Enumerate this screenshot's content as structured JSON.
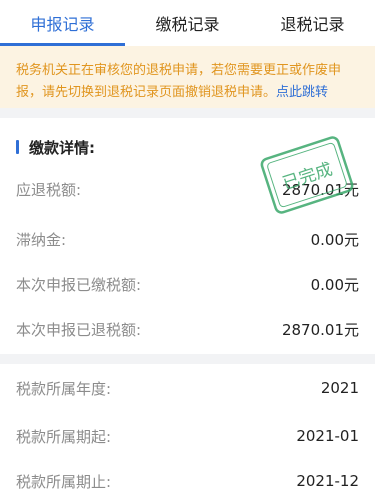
{
  "tabs": [
    {
      "label": "申报记录"
    },
    {
      "label": "缴税记录"
    },
    {
      "label": "退税记录"
    }
  ],
  "notice": {
    "text": "税务机关正在审核您的退税申请，若您需要更正或作废申报，请先切换到退税记录页面撤销退税申请。",
    "link_text": "点此跳转"
  },
  "payment_details": {
    "title": "缴款详情:",
    "stamp_text": "已完成",
    "rows": [
      {
        "label": "应退税额:",
        "value": "2870.01元"
      },
      {
        "label": "滞纳金:",
        "value": "0.00元"
      },
      {
        "label": "本次申报已缴税额:",
        "value": "0.00元"
      },
      {
        "label": "本次申报已退税额:",
        "value": "2870.01元"
      }
    ]
  },
  "period_info": {
    "rows": [
      {
        "label": "税款所属年度:",
        "value": "2021"
      },
      {
        "label": "税款所属期起:",
        "value": "2021-01"
      },
      {
        "label": "税款所属期止:",
        "value": "2021-12"
      }
    ]
  },
  "colors": {
    "accent": "#2f6fd6",
    "notice_text": "#e0951f",
    "notice_bg": "#fcf3e2",
    "stamp": "#3aa86b"
  }
}
